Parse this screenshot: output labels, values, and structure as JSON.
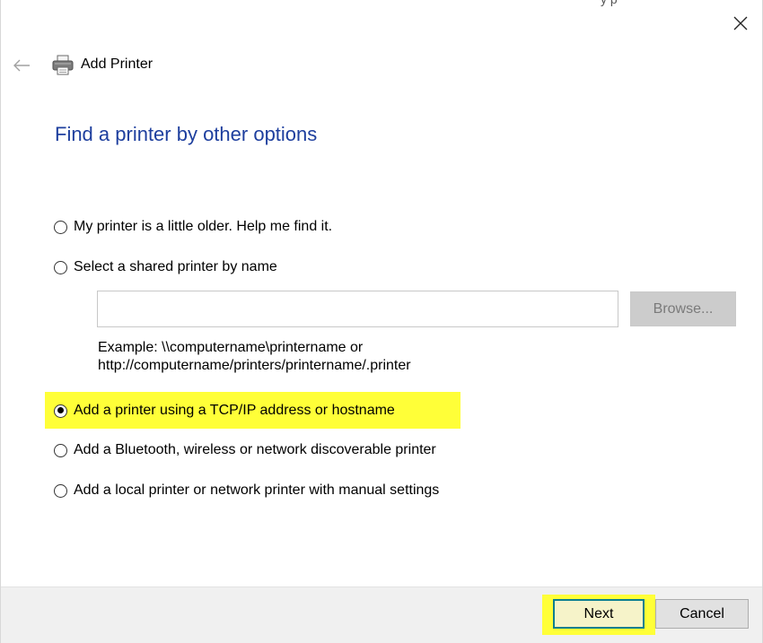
{
  "window": {
    "title": "Add Printer",
    "top_fragment": "y p"
  },
  "heading": "Find a printer by other options",
  "options": [
    {
      "label": "My printer is a little older. Help me find it.",
      "checked": false
    },
    {
      "label": "Select a shared printer by name",
      "checked": false
    },
    {
      "label": "Add a printer using a TCP/IP address or hostname",
      "checked": true
    },
    {
      "label": "Add a Bluetooth, wireless or network discoverable printer",
      "checked": false
    },
    {
      "label": "Add a local printer or network printer with manual settings",
      "checked": false
    }
  ],
  "shared_printer": {
    "value": "",
    "browse_label": "Browse...",
    "example_line1": "Example: \\\\computername\\printername or",
    "example_line2": "http://computername/printers/printername/.printer"
  },
  "footer": {
    "next_label": "Next",
    "cancel_label": "Cancel"
  },
  "colors": {
    "heading": "#1e3f9e",
    "highlight": "#ffff38",
    "next_border": "#0b7f8f"
  },
  "icons": {
    "close": "close-icon",
    "back": "back-arrow-icon",
    "printer": "printer-icon"
  }
}
